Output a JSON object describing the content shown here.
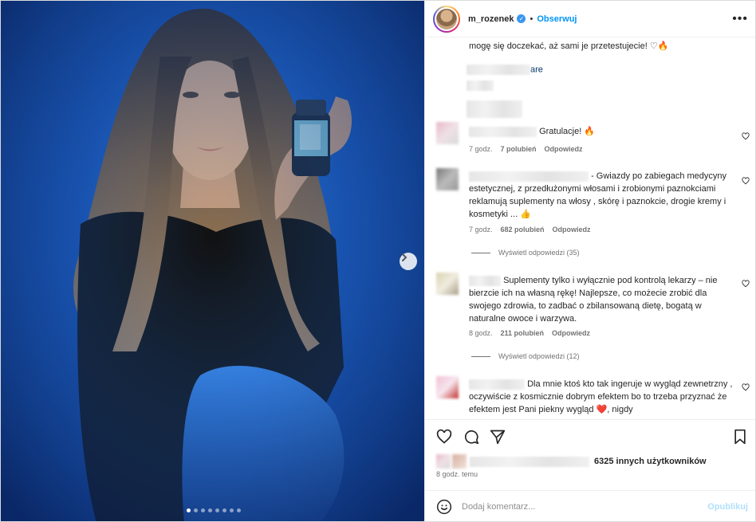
{
  "post": {
    "username": "m_rozenek",
    "follow_label": "Obserwuj",
    "separator": "•",
    "more_icon": "more-horizontal-icon",
    "caption_tail": "mogę się doczekać, aż sami je przetestujecie! ♡🔥",
    "caption_link_fragment": "are",
    "likes_text": "6325 innych użytkowników",
    "time": "8 godz. temu",
    "carousel_count": 8,
    "carousel_active": 0
  },
  "comments": [
    {
      "text": "Gratulacje! 🔥",
      "age": "7 godz.",
      "likes": "7 polubień",
      "reply": "Odpowiedz"
    },
    {
      "text": "- Gwiazdy po zabiegach medycyny estetycznej, z przedłużonymi włosami i zrobionymi paznokciami reklamują suplementy na włosy , skórę i paznokcie, drogie kremy i kosmetyki ... 👍",
      "age": "7 godz.",
      "likes": "682 polubień",
      "reply": "Odpowiedz",
      "view_replies": "Wyświetl odpowiedzi (35)"
    },
    {
      "text": "Suplementy tylko i wyłącznie pod kontrolą lekarzy – nie bierzcie ich na własną rękę! Najlepsze, co możecie zrobić dla swojego zdrowia, to zadbać o zbilansowaną dietę, bogatą w naturalne owoce i warzywa.",
      "age": "8 godz.",
      "likes": "211 polubień",
      "reply": "Odpowiedz",
      "view_replies": "Wyświetl odpowiedzi (12)"
    },
    {
      "text": "Dla mnie ktoś kto tak ingeruje w wygląd zewnetrzny , oczywiście z kosmicznie dobrym efektem bo to trzeba przyznać że efektem jest Pani piekny wygląd ❤️, nigdy"
    }
  ],
  "composer": {
    "placeholder": "Dodaj komentarz...",
    "publish_label": "Opublikuj"
  },
  "colors": {
    "accent": "#0095f6",
    "background_blue": "#1753b5",
    "text": "#262626",
    "muted": "#737373"
  }
}
